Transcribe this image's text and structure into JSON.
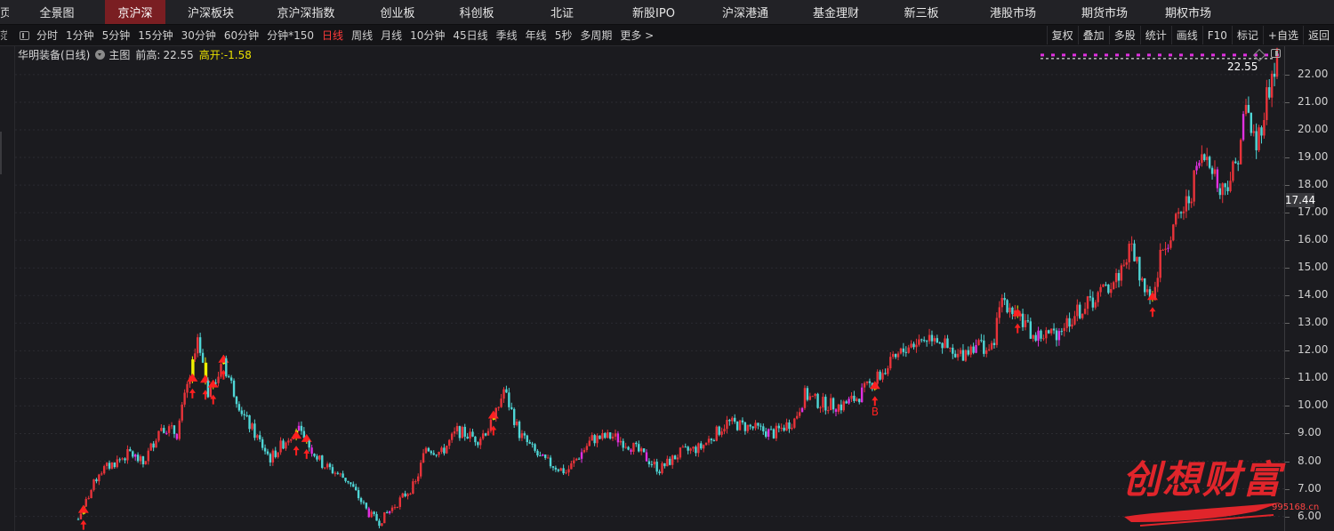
{
  "top_nav": {
    "left_stub": "页",
    "tabs": [
      "全景图",
      "京沪深",
      "沪深板块",
      "京沪深指数",
      "创业板",
      "科创板",
      "北证",
      "新股IPO",
      "沪深港通",
      "基金理财",
      "新三板",
      "港股市场",
      "期货市场",
      "期权市场"
    ],
    "active": "京沪深"
  },
  "toolbar": {
    "left_stub": "范",
    "periods": [
      "分时",
      "1分钟",
      "5分钟",
      "15分钟",
      "30分钟",
      "60分钟",
      "分钟*150",
      "日线",
      "周线",
      "月线",
      "10分钟",
      "45日线",
      "季线",
      "年线",
      "5秒",
      "多周期",
      "更多 >"
    ],
    "active_period": "日线",
    "right_tools": [
      "复权",
      "叠加",
      "多股",
      "统计",
      "画线",
      "F10",
      "标记",
      "+自选",
      "返回"
    ]
  },
  "legend": {
    "stock": "华明装备(日线)",
    "main_label": "主图",
    "prev_high_label": "前高:",
    "prev_high_value": "22.55",
    "gap_label": "高开:",
    "gap_value": "-1.58"
  },
  "price_axis": {
    "ticks": [
      "22.00",
      "21.00",
      "20.00",
      "19.00",
      "18.00",
      "17.00",
      "16.00",
      "15.00",
      "14.00",
      "13.00",
      "12.00",
      "11.00",
      "10.00",
      "9.00",
      "8.00",
      "7.00",
      "6.00"
    ],
    "current_price": "17.44",
    "high_label": "22.55"
  },
  "signal_label": "B",
  "watermark": {
    "text": "创想财富",
    "url": "995168.cn"
  },
  "colors": {
    "up": "#e8333a",
    "down": "#4fd6d6",
    "signal_yellow": "#f0f000",
    "signal_magenta": "#e030e0",
    "active_tab": "#7a1e22",
    "active_period": "#ff3b3b"
  },
  "chart_data": {
    "type": "candlestick",
    "title": "华明装备(日线)",
    "ylim": [
      5.6,
      22.9
    ],
    "trend_points": [
      [
        0,
        5.9
      ],
      [
        8,
        7.6
      ],
      [
        20,
        8.3
      ],
      [
        25,
        7.9
      ],
      [
        32,
        9.3
      ],
      [
        38,
        9.0
      ],
      [
        42,
        10.7
      ],
      [
        46,
        12.2
      ],
      [
        50,
        10.5
      ],
      [
        56,
        11.5
      ],
      [
        64,
        9.6
      ],
      [
        74,
        8.1
      ],
      [
        84,
        9.2
      ],
      [
        94,
        7.9
      ],
      [
        104,
        7.3
      ],
      [
        112,
        6.1
      ],
      [
        116,
        5.8
      ],
      [
        124,
        6.6
      ],
      [
        130,
        7.2
      ],
      [
        134,
        8.5
      ],
      [
        140,
        8.3
      ],
      [
        146,
        9.1
      ],
      [
        154,
        8.8
      ],
      [
        160,
        9.4
      ],
      [
        164,
        10.6
      ],
      [
        170,
        9.0
      ],
      [
        178,
        8.1
      ],
      [
        188,
        7.6
      ],
      [
        198,
        8.8
      ],
      [
        206,
        8.9
      ],
      [
        214,
        8.5
      ],
      [
        224,
        7.7
      ],
      [
        232,
        8.3
      ],
      [
        240,
        8.5
      ],
      [
        250,
        9.4
      ],
      [
        260,
        9.2
      ],
      [
        268,
        9.0
      ],
      [
        276,
        9.5
      ],
      [
        280,
        10.4
      ],
      [
        286,
        10.1
      ],
      [
        294,
        10.0
      ],
      [
        300,
        10.3
      ],
      [
        310,
        11.2
      ],
      [
        320,
        12.2
      ],
      [
        330,
        12.6
      ],
      [
        338,
        11.7
      ],
      [
        346,
        12.3
      ],
      [
        352,
        12.0
      ],
      [
        356,
        13.9
      ],
      [
        362,
        13.4
      ],
      [
        368,
        12.5
      ],
      [
        376,
        12.6
      ],
      [
        384,
        13.3
      ],
      [
        392,
        13.9
      ],
      [
        400,
        14.6
      ],
      [
        406,
        15.8
      ],
      [
        410,
        14.5
      ],
      [
        414,
        13.8
      ],
      [
        418,
        15.8
      ],
      [
        422,
        16.4
      ],
      [
        428,
        17.5
      ],
      [
        432,
        18.8
      ],
      [
        436,
        19.1
      ],
      [
        440,
        17.7
      ],
      [
        446,
        18.7
      ],
      [
        450,
        20.8
      ],
      [
        454,
        19.4
      ],
      [
        458,
        21.2
      ],
      [
        462,
        22.6
      ]
    ],
    "buy_signal_indices": [
      2,
      44,
      49,
      52,
      56,
      84,
      88,
      160,
      307,
      362,
      414
    ],
    "b_label_index": 307
  }
}
